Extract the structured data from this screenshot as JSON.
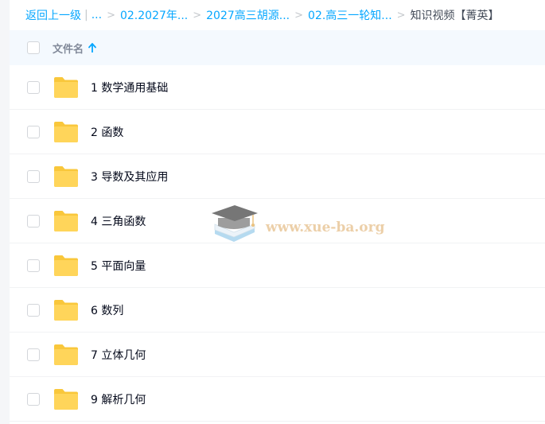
{
  "breadcrumb": {
    "back": "返回上一级",
    "pipe": "|",
    "ellipsis": "...",
    "sep": ">",
    "crumbs": [
      "02.2027年...",
      "2027高三胡源...",
      "02.高三一轮知..."
    ],
    "current": "知识视频【菁英】"
  },
  "header": {
    "column_label": "文件名"
  },
  "files": [
    {
      "name": "1 数学通用基础"
    },
    {
      "name": "2 函数"
    },
    {
      "name": "3 导数及其应用"
    },
    {
      "name": "4 三角函数"
    },
    {
      "name": "5 平面向量"
    },
    {
      "name": "6 数列"
    },
    {
      "name": "7 立体几何"
    },
    {
      "name": "9 解析几何"
    }
  ],
  "watermark": {
    "text": "www.xue-ba.org"
  },
  "colors": {
    "link": "#06a7ff",
    "folder": "#ffd04d",
    "header_bg": "#f4f9fe",
    "watermark": "#e9c79a"
  }
}
